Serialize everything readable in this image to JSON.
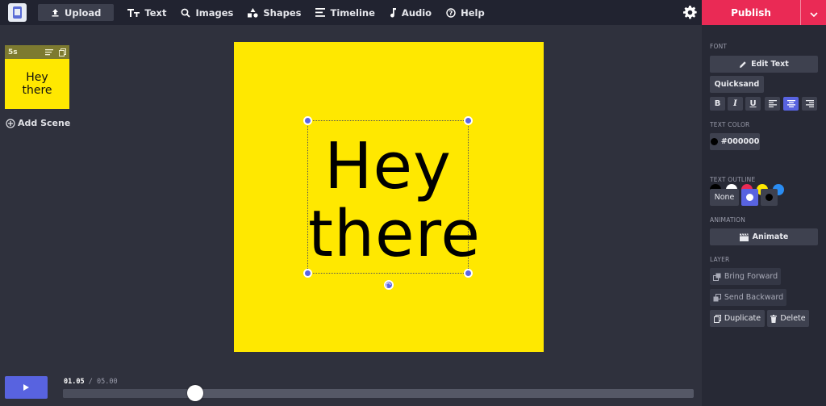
{
  "topbar": {
    "upload": "Upload",
    "items": [
      {
        "label": "Text",
        "icon": "text-icon"
      },
      {
        "label": "Images",
        "icon": "search-icon"
      },
      {
        "label": "Shapes",
        "icon": "shapes-icon"
      },
      {
        "label": "Timeline",
        "icon": "timeline-icon"
      },
      {
        "label": "Audio",
        "icon": "music-note-icon"
      },
      {
        "label": "Help",
        "icon": "help-icon"
      }
    ],
    "publish": "Publish"
  },
  "scenes": [
    {
      "duration": "5s",
      "preview_text": "Hey there"
    }
  ],
  "add_scene": "Add Scene",
  "canvas": {
    "text": "Hey there",
    "background": "#ffe800",
    "text_color": "#000000"
  },
  "panel": {
    "font_heading": "FONT",
    "edit_text": "Edit Text",
    "font_name": "Quicksand",
    "text_color_heading": "TEXT COLOR",
    "color_value": "#000000",
    "swatches": [
      "#000000",
      "#ffffff",
      "#ea2a55",
      "#ffe800",
      "#2a8cf2"
    ],
    "text_outline_heading": "TEXT OUTLINE",
    "outline_none": "None",
    "animation_heading": "ANIMATION",
    "animate": "Animate",
    "layer_heading": "LAYER",
    "bring_forward": "Bring Forward",
    "send_backward": "Send Backward",
    "duplicate": "Duplicate",
    "delete": "Delete"
  },
  "playback": {
    "current": "01.05",
    "separator": "/",
    "total": "05.00",
    "progress": 0.21
  },
  "colors": {
    "accent": "#5863e0",
    "publish": "#ea2a55"
  }
}
